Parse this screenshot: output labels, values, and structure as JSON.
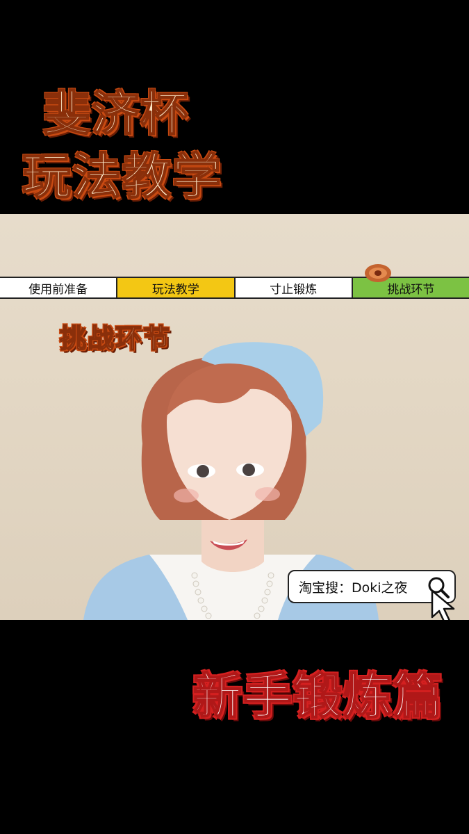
{
  "header": {
    "title_line_1": "斐济杯",
    "title_line_2": "玩法教学"
  },
  "chapters": [
    {
      "label": "使用前准备"
    },
    {
      "label": "玩法教学"
    },
    {
      "label": "寸止锻炼"
    },
    {
      "label": "挑战环节"
    }
  ],
  "current_chapter_index": 3,
  "section_label": "挑战环节",
  "search_chip": {
    "text": "淘宝搜：Doki之夜",
    "icon": "search-icon"
  },
  "cursor_icon": "cursor-arrow-icon",
  "footer": {
    "subtitle": "新手锻炼篇"
  },
  "colors": {
    "chapter_active": "#7cc243",
    "chapter_highlight": "#f3c714",
    "title_fill": "#fde9c9",
    "title_stroke": "#c84a12",
    "subtitle_stroke": "#d42020"
  }
}
